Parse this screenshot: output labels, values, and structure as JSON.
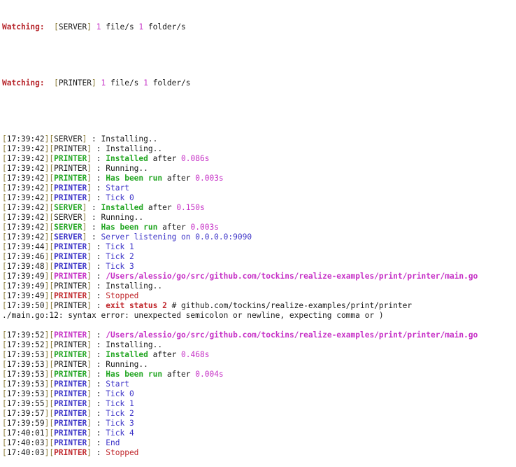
{
  "terminal": {
    "watch": [
      {
        "label": "Watching:",
        "spacer": "  ",
        "name": "SERVER",
        "files": "1",
        "files_text": " file/s ",
        "folders": "1",
        "folders_text": " folder/s"
      },
      {
        "label": "Watching:",
        "spacer": "  ",
        "name": "PRINTER",
        "files": "1",
        "files_text": " file/s ",
        "folders": "1",
        "folders_text": " folder/s"
      }
    ],
    "logs": [
      {
        "time": "17:39:42",
        "tag": "SERVER",
        "tag_style": "plain",
        "sep": " : ",
        "parts": [
          {
            "t": "Installing..",
            "s": "plain"
          }
        ]
      },
      {
        "time": "17:39:42",
        "tag": "PRINTER",
        "tag_style": "plain",
        "sep": " : ",
        "parts": [
          {
            "t": "Installing..",
            "s": "plain"
          }
        ]
      },
      {
        "time": "17:39:42",
        "tag": "PRINTER",
        "tag_style": "green",
        "sep": " : ",
        "parts": [
          {
            "t": "Installed",
            "s": "green"
          },
          {
            "t": " after ",
            "s": "plain"
          },
          {
            "t": "0.086s",
            "s": "num"
          }
        ]
      },
      {
        "time": "17:39:42",
        "tag": "PRINTER",
        "tag_style": "plain",
        "sep": " : ",
        "parts": [
          {
            "t": "Running..",
            "s": "plain"
          }
        ]
      },
      {
        "time": "17:39:42",
        "tag": "PRINTER",
        "tag_style": "green",
        "sep": " : ",
        "parts": [
          {
            "t": "Has been run",
            "s": "green"
          },
          {
            "t": " after ",
            "s": "plain"
          },
          {
            "t": "0.003s",
            "s": "num"
          }
        ]
      },
      {
        "time": "17:39:42",
        "tag": "PRINTER",
        "tag_style": "blue",
        "sep": " : ",
        "parts": [
          {
            "t": "Start",
            "s": "blue"
          }
        ]
      },
      {
        "time": "17:39:42",
        "tag": "PRINTER",
        "tag_style": "blue",
        "sep": " : ",
        "parts": [
          {
            "t": "Tick 0",
            "s": "blue"
          }
        ]
      },
      {
        "time": "17:39:42",
        "tag": "SERVER",
        "tag_style": "green",
        "sep": " : ",
        "parts": [
          {
            "t": "Installed",
            "s": "green"
          },
          {
            "t": " after ",
            "s": "plain"
          },
          {
            "t": "0.150s",
            "s": "num"
          }
        ]
      },
      {
        "time": "17:39:42",
        "tag": "SERVER",
        "tag_style": "plain",
        "sep": " : ",
        "parts": [
          {
            "t": "Running..",
            "s": "plain"
          }
        ]
      },
      {
        "time": "17:39:42",
        "tag": "SERVER",
        "tag_style": "green",
        "sep": " : ",
        "parts": [
          {
            "t": "Has been run",
            "s": "green"
          },
          {
            "t": " after ",
            "s": "plain"
          },
          {
            "t": "0.003s",
            "s": "num"
          }
        ]
      },
      {
        "time": "17:39:42",
        "tag": "SERVER",
        "tag_style": "blue",
        "sep": " : ",
        "parts": [
          {
            "t": "Server listening on 0.0.0.0:9090",
            "s": "blue"
          }
        ]
      },
      {
        "time": "17:39:44",
        "tag": "PRINTER",
        "tag_style": "blue",
        "sep": " : ",
        "parts": [
          {
            "t": "Tick 1",
            "s": "blue"
          }
        ]
      },
      {
        "time": "17:39:46",
        "tag": "PRINTER",
        "tag_style": "blue",
        "sep": " : ",
        "parts": [
          {
            "t": "Tick 2",
            "s": "blue"
          }
        ]
      },
      {
        "time": "17:39:48",
        "tag": "PRINTER",
        "tag_style": "blue",
        "sep": " : ",
        "parts": [
          {
            "t": "Tick 3",
            "s": "blue"
          }
        ]
      },
      {
        "time": "17:39:49",
        "tag": "PRINTER",
        "tag_style": "magenta",
        "sep": " : ",
        "parts": [
          {
            "t": "/Users/alessio/go/src/github.com/tockins/realize-examples/print/printer/main.go",
            "s": "magenta"
          }
        ]
      },
      {
        "time": "17:39:49",
        "tag": "PRINTER",
        "tag_style": "plain",
        "sep": " : ",
        "parts": [
          {
            "t": "Installing..",
            "s": "plain"
          }
        ]
      },
      {
        "time": "17:39:49",
        "tag": "PRINTER",
        "tag_style": "red",
        "sep": " : ",
        "parts": [
          {
            "t": "Stopped",
            "s": "redplain"
          }
        ]
      },
      {
        "time": "17:39:50",
        "tag": "PRINTER",
        "tag_style": "plain",
        "sep": " : ",
        "parts": [
          {
            "t": "exit status 2",
            "s": "red"
          },
          {
            "t": " # github.com/tockins/realize-examples/print/printer",
            "s": "plain"
          }
        ]
      },
      {
        "raw": "./main.go:12: syntax error: unexpected semicolon or newline, expecting comma or )"
      },
      {
        "blank": true
      },
      {
        "time": "17:39:52",
        "tag": "PRINTER",
        "tag_style": "magenta",
        "sep": " : ",
        "parts": [
          {
            "t": "/Users/alessio/go/src/github.com/tockins/realize-examples/print/printer/main.go",
            "s": "magenta"
          }
        ]
      },
      {
        "time": "17:39:52",
        "tag": "PRINTER",
        "tag_style": "plain",
        "sep": " : ",
        "parts": [
          {
            "t": "Installing..",
            "s": "plain"
          }
        ]
      },
      {
        "time": "17:39:53",
        "tag": "PRINTER",
        "tag_style": "green",
        "sep": " : ",
        "parts": [
          {
            "t": "Installed",
            "s": "green"
          },
          {
            "t": " after ",
            "s": "plain"
          },
          {
            "t": "0.468s",
            "s": "num"
          }
        ]
      },
      {
        "time": "17:39:53",
        "tag": "PRINTER",
        "tag_style": "plain",
        "sep": " : ",
        "parts": [
          {
            "t": "Running..",
            "s": "plain"
          }
        ]
      },
      {
        "time": "17:39:53",
        "tag": "PRINTER",
        "tag_style": "green",
        "sep": " : ",
        "parts": [
          {
            "t": "Has been run",
            "s": "green"
          },
          {
            "t": " after ",
            "s": "plain"
          },
          {
            "t": "0.004s",
            "s": "num"
          }
        ]
      },
      {
        "time": "17:39:53",
        "tag": "PRINTER",
        "tag_style": "blue",
        "sep": " : ",
        "parts": [
          {
            "t": "Start",
            "s": "blue"
          }
        ]
      },
      {
        "time": "17:39:53",
        "tag": "PRINTER",
        "tag_style": "blue",
        "sep": " : ",
        "parts": [
          {
            "t": "Tick 0",
            "s": "blue"
          }
        ]
      },
      {
        "time": "17:39:55",
        "tag": "PRINTER",
        "tag_style": "blue",
        "sep": " : ",
        "parts": [
          {
            "t": "Tick 1",
            "s": "blue"
          }
        ]
      },
      {
        "time": "17:39:57",
        "tag": "PRINTER",
        "tag_style": "blue",
        "sep": " : ",
        "parts": [
          {
            "t": "Tick 2",
            "s": "blue"
          }
        ]
      },
      {
        "time": "17:39:59",
        "tag": "PRINTER",
        "tag_style": "blue",
        "sep": " : ",
        "parts": [
          {
            "t": "Tick 3",
            "s": "blue"
          }
        ]
      },
      {
        "time": "17:40:01",
        "tag": "PRINTER",
        "tag_style": "blue",
        "sep": " : ",
        "parts": [
          {
            "t": "Tick 4",
            "s": "blue"
          }
        ]
      },
      {
        "time": "17:40:03",
        "tag": "PRINTER",
        "tag_style": "blue",
        "sep": " : ",
        "parts": [
          {
            "t": "End",
            "s": "blue"
          }
        ]
      },
      {
        "time": "17:40:03",
        "tag": "PRINTER",
        "tag_style": "red",
        "sep": " : ",
        "parts": [
          {
            "t": "Stopped",
            "s": "redplain"
          }
        ]
      }
    ]
  },
  "colors": {
    "watch_label": "#b8292f",
    "bracket": "#8a7a34",
    "number": "#c631c6",
    "success": "#23a623",
    "info": "#3d34c8",
    "error": "#c0262b",
    "text": "#1a1a1a",
    "background": "#ffffff"
  }
}
